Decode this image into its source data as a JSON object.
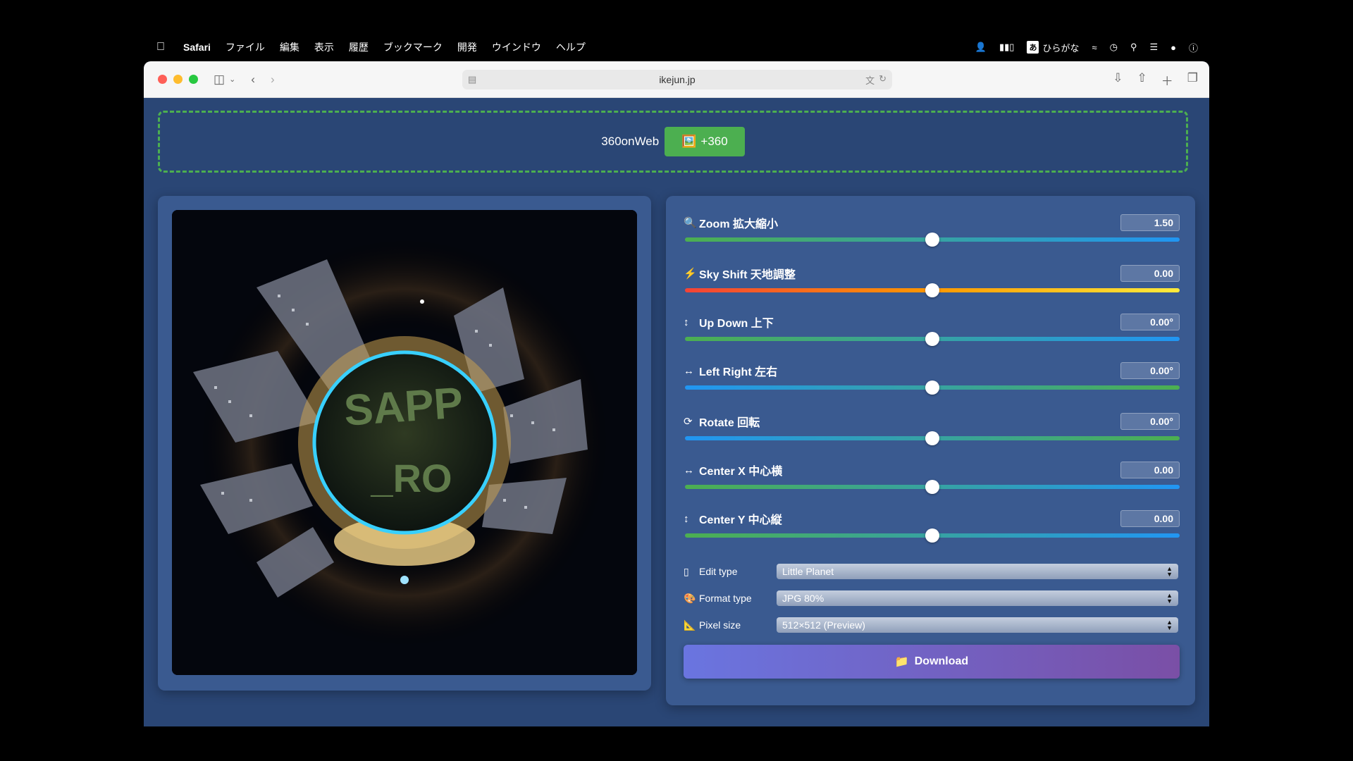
{
  "menubar": {
    "app_name": "Safari",
    "items": [
      "ファイル",
      "編集",
      "表示",
      "履歴",
      "ブックマーク",
      "開発",
      "ウインドウ",
      "ヘルプ"
    ],
    "ime_box": "あ",
    "ime_label": "ひらがな"
  },
  "browser": {
    "url": "ikejun.jp"
  },
  "banner": {
    "label": "360onWeb",
    "button_label": "+360",
    "button_icon": "🖼️"
  },
  "sliders": [
    {
      "icon": "🔍",
      "label": "Zoom 拡大縮小",
      "value": "1.50",
      "fraction": 0.5,
      "gradient": "green-blue"
    },
    {
      "icon": "⚡",
      "label": "Sky Shift 天地調整",
      "value": "0.00",
      "fraction": 0.5,
      "gradient": "red-yellow"
    },
    {
      "icon": "↕",
      "label": "Up Down 上下",
      "value": "0.00°",
      "fraction": 0.5,
      "gradient": "green-blue"
    },
    {
      "icon": "↔",
      "label": "Left Right 左右",
      "value": "0.00°",
      "fraction": 0.5,
      "gradient": "blue-green"
    },
    {
      "icon": "⟳",
      "label": "Rotate 回転",
      "value": "0.00°",
      "fraction": 0.5,
      "gradient": "blue-green"
    },
    {
      "icon": "↔",
      "label": "Center X 中心横",
      "value": "0.00",
      "fraction": 0.5,
      "gradient": "green-blue"
    },
    {
      "icon": "↕",
      "label": "Center Y 中心縦",
      "value": "0.00",
      "fraction": 0.5,
      "gradient": "green-blue"
    }
  ],
  "selects": [
    {
      "icon": "▯",
      "label": "Edit type",
      "value": "Little Planet"
    },
    {
      "icon": "🎨",
      "label": "Format type",
      "value": "JPG 80%"
    },
    {
      "icon": "📐",
      "label": "Pixel size",
      "value": "512×512 (Preview)"
    }
  ],
  "download": {
    "icon": "📁",
    "label": "Download"
  },
  "preview": {
    "ground_text_1": "SAPP",
    "ground_text_2": "_RO"
  }
}
